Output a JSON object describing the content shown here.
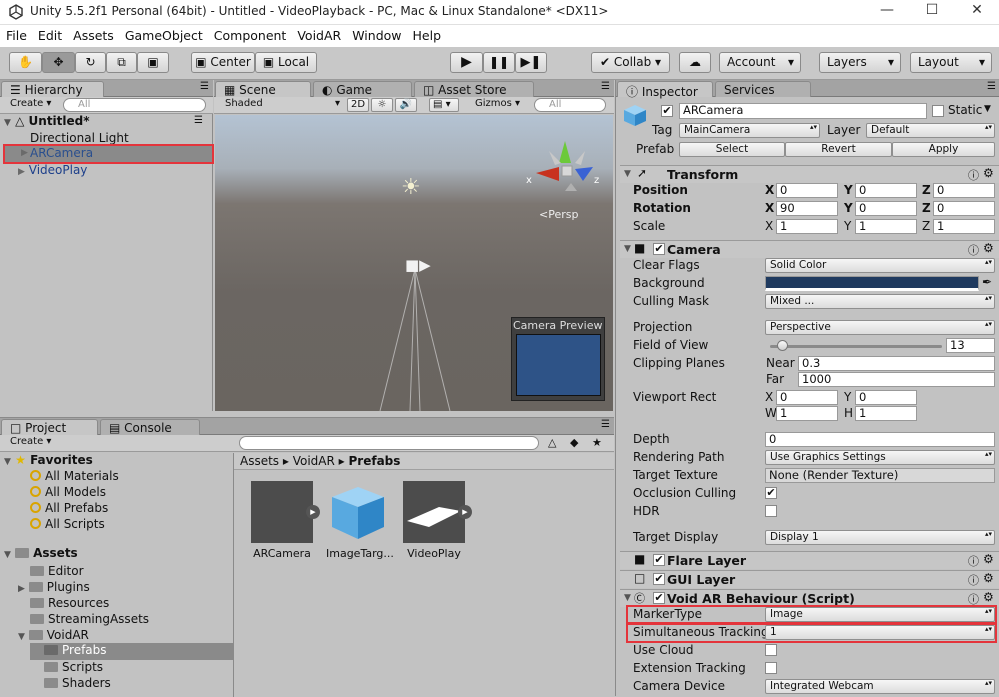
{
  "window": {
    "title": "Unity 5.5.2f1 Personal (64bit) - Untitled - VideoPlayback - PC, Mac & Linux Standalone* <DX11>"
  },
  "menu": [
    "File",
    "Edit",
    "Assets",
    "GameObject",
    "Component",
    "VoidAR",
    "Window",
    "Help"
  ],
  "toolbar": {
    "pivot": "Center",
    "space": "Local",
    "collab": "Collab",
    "account": "Account",
    "layers": "Layers",
    "layout": "Layout"
  },
  "hierarchy": {
    "tab": "Hierarchy",
    "create": "Create",
    "search": "All",
    "scene": "Untitled*",
    "items": [
      "Directional Light",
      "ARCamera",
      "VideoPlay"
    ]
  },
  "scene": {
    "tabs": {
      "scene": "Scene",
      "game": "Game",
      "store": "Asset Store"
    },
    "shading": "Shaded",
    "mode2d": "2D",
    "gizmos": "Gizmos",
    "search": "All",
    "persp": "<Persp",
    "preview": "Camera Preview",
    "axis_x": "x",
    "axis_z": "z"
  },
  "project": {
    "tabs": {
      "project": "Project",
      "console": "Console"
    },
    "create": "Create",
    "favorites": {
      "label": "Favorites",
      "items": [
        "All Materials",
        "All Models",
        "All Prefabs",
        "All Scripts"
      ]
    },
    "assets": {
      "label": "Assets",
      "items": [
        "Editor",
        "Plugins",
        "Resources",
        "StreamingAssets",
        "VoidAR",
        "Prefabs",
        "Scripts",
        "Shaders"
      ]
    },
    "breadcrumb": [
      "Assets",
      "VoidAR",
      "Prefabs"
    ],
    "files": [
      "ARCamera",
      "ImageTarg...",
      "VideoPlay"
    ]
  },
  "inspector": {
    "tabs": {
      "inspector": "Inspector",
      "services": "Services"
    },
    "name": "ARCamera",
    "static_label": "Static",
    "tag_label": "Tag",
    "tag": "MainCamera",
    "layer_label": "Layer",
    "layer": "Default",
    "prefab_label": "Prefab",
    "prefab_buttons": [
      "Select",
      "Revert",
      "Apply"
    ],
    "transform": {
      "title": "Transform",
      "rows": [
        {
          "label": "Position",
          "x": "0",
          "y": "0",
          "z": "0"
        },
        {
          "label": "Rotation",
          "x": "90",
          "y": "0",
          "z": "0"
        },
        {
          "label": "Scale",
          "x": "1",
          "y": "1",
          "z": "1"
        }
      ]
    },
    "camera": {
      "title": "Camera",
      "clear_flags_label": "Clear Flags",
      "clear_flags": "Solid Color",
      "background_label": "Background",
      "background_color": "#1f3a5f",
      "culling_mask_label": "Culling Mask",
      "culling_mask": "Mixed ...",
      "projection_label": "Projection",
      "projection": "Perspective",
      "fov_label": "Field of View",
      "fov": "13",
      "fov_fraction": 0.07,
      "clipping_label": "Clipping Planes",
      "near_label": "Near",
      "near": "0.3",
      "far_label": "Far",
      "far": "1000",
      "viewport_label": "Viewport Rect",
      "vx": "0",
      "vy": "0",
      "vw": "1",
      "vh": "1",
      "depth_label": "Depth",
      "depth": "0",
      "rendering_path_label": "Rendering Path",
      "rendering_path": "Use Graphics Settings",
      "target_texture_label": "Target Texture",
      "target_texture": "None (Render Texture)",
      "occlusion_label": "Occlusion Culling",
      "hdr_label": "HDR",
      "target_display_label": "Target Display",
      "target_display": "Display 1"
    },
    "flare": {
      "title": "Flare Layer"
    },
    "gui": {
      "title": "GUI Layer"
    },
    "voidar": {
      "title": "Void AR Behaviour (Script)",
      "marker_type_label": "MarkerType",
      "marker_type": "Image",
      "sim_tracking_label": "Simultaneous Tracking",
      "sim_tracking": "1",
      "use_cloud_label": "Use Cloud",
      "ext_tracking_label": "Extension Tracking",
      "camera_device_label": "Camera Device",
      "camera_device": "Integrated Webcam"
    }
  },
  "colors": {
    "highlight": "#e4343b",
    "selection": "#3d6fb6",
    "preview_bg": "#2e5387"
  }
}
